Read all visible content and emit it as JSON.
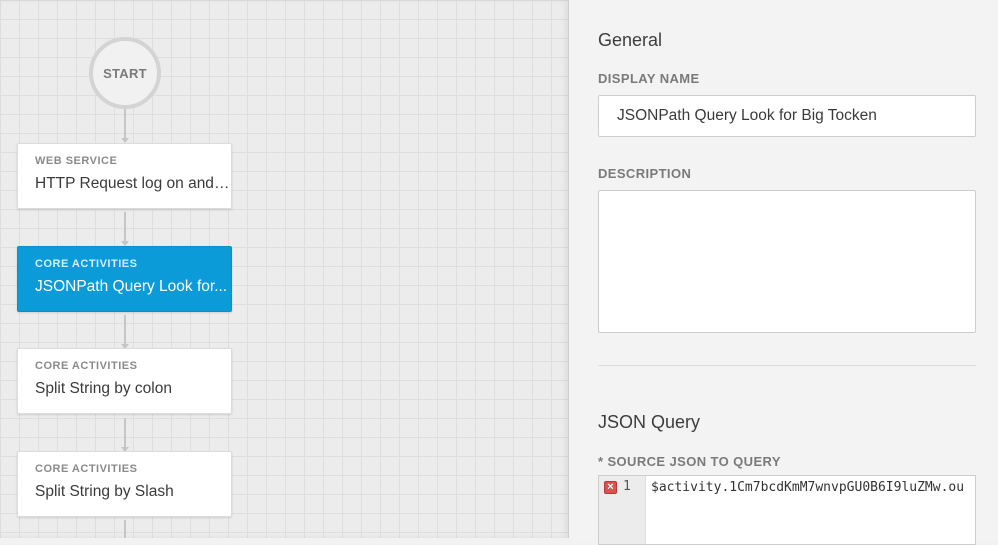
{
  "flow": {
    "start_label": "START",
    "activities": [
      {
        "category": "WEB SERVICE",
        "name": "HTTP Request log on and ..."
      },
      {
        "category": "CORE ACTIVITIES",
        "name": "JSONPath Query Look for..."
      },
      {
        "category": "CORE ACTIVITIES",
        "name": "Split String by colon"
      },
      {
        "category": "CORE ACTIVITIES",
        "name": "Split String by Slash"
      }
    ]
  },
  "panel": {
    "general_title": "General",
    "display_name_label": "DISPLAY NAME",
    "display_name_value": "JSONPath Query Look for Big Tocken",
    "description_label": "DESCRIPTION",
    "description_value": "",
    "json_query_title": "JSON Query",
    "source_json_label": "* SOURCE JSON TO QUERY",
    "source_line_number": "1",
    "source_code": "$activity.1Cm7bcdKmM7wnvpGU0B6I9luZMw.ou"
  },
  "colors": {
    "selected_activity": "#0a9bd8",
    "error": "#d9534f"
  },
  "icons": {
    "error": "error-icon"
  }
}
